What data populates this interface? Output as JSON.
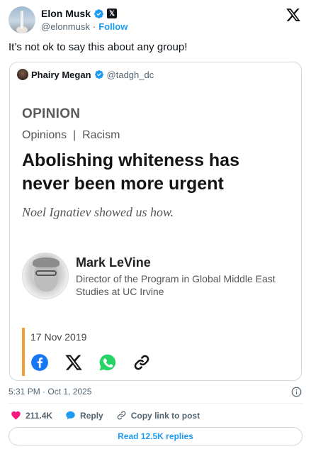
{
  "author": {
    "name": "Elon Musk",
    "handle": "@elonmusk",
    "separator": "·",
    "follow_label": "Follow",
    "verified_color": "#1d9bf0",
    "avatar_icon": "rocket-launch-avatar"
  },
  "tweet": {
    "text": "It’s not ok to say this about any group!"
  },
  "quoted": {
    "name": "Phairy Megan",
    "handle": "@tadgh_dc",
    "article": {
      "kicker": "OPINION",
      "section": "Opinions  |  Racism",
      "headline": "Abolishing whiteness has never been more urgent",
      "subhead": "Noel Ignatiev showed us how.",
      "author_name": "Mark LeVine",
      "author_title": "Director of the Program in Global Middle East Studies at UC Irvine",
      "date": "17 Nov 2019",
      "accent_color": "#f0a030",
      "share_icons": [
        "facebook-icon",
        "x-icon",
        "whatsapp-icon",
        "link-icon"
      ]
    }
  },
  "meta": {
    "timestamp": "5:31 PM · Oct 1, 2025"
  },
  "actions": {
    "likes": "211.4K",
    "reply_label": "Reply",
    "copy_link_label": "Copy link to post"
  },
  "read_replies_label": "Read 12.5K replies",
  "colors": {
    "brand_blue": "#1d9bf0",
    "like_pink": "#f91880",
    "text_secondary": "#536471"
  }
}
